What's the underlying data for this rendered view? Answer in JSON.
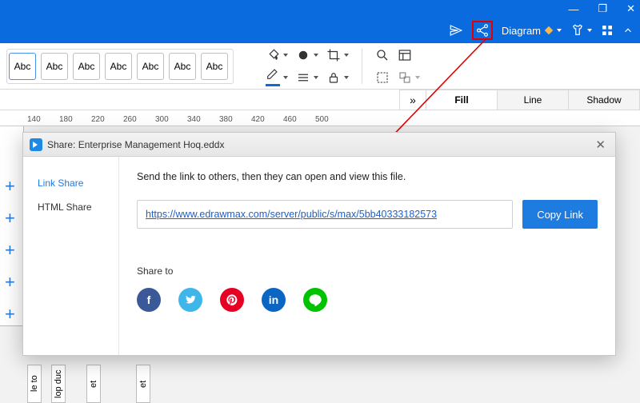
{
  "window": {
    "min": "—",
    "max": "❐",
    "close": "✕"
  },
  "menubar": {
    "diagram_label": "Diagram"
  },
  "ribbon": {
    "abc": "Abc"
  },
  "tabs": {
    "fill": "Fill",
    "line": "Line",
    "shadow": "Shadow",
    "chev": "»"
  },
  "ruler": {
    "t140": "140",
    "t180": "180",
    "t220": "220",
    "t260": "260",
    "t300": "300",
    "t340": "340",
    "t380": "380",
    "t420": "420",
    "t460": "460",
    "t500": "500"
  },
  "dialog": {
    "title": "Share: Enterprise Management Hoq.eddx",
    "close": "✕",
    "side": {
      "link": "Link Share",
      "html": "HTML Share"
    },
    "desc": "Send the link to others, then they can open and view this file.",
    "url": "https://www.edrawmax.com/server/public/s/max/5bb40333182573",
    "copy": "Copy Link",
    "share_to": "Share to",
    "socials": {
      "fb": "f",
      "tw": "",
      "pi": "",
      "li": "in",
      "ln": ""
    }
  },
  "canvas": {
    "le": "le to",
    "lop": "lop duc",
    "et1": "et",
    "et2": "et"
  }
}
